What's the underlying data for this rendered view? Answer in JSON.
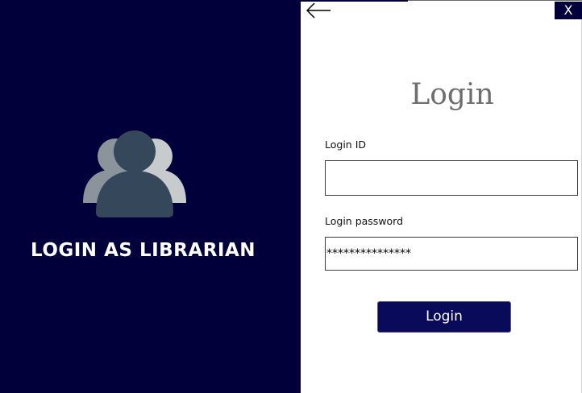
{
  "left_panel": {
    "title": "LOGIN AS LIBRARIAN",
    "icon": "users-group-icon",
    "background": "#02003a"
  },
  "header": {
    "back_icon": "arrow-left-icon",
    "close_label": "X"
  },
  "form": {
    "title": "Login",
    "login_id_label": "Login ID",
    "login_id_value": "",
    "password_label": "Login password",
    "password_value": "***************",
    "submit_label": "Login"
  },
  "colors": {
    "accent": "#02003a",
    "button": "#0a0a5a",
    "title_gray": "#6e6e6e"
  }
}
